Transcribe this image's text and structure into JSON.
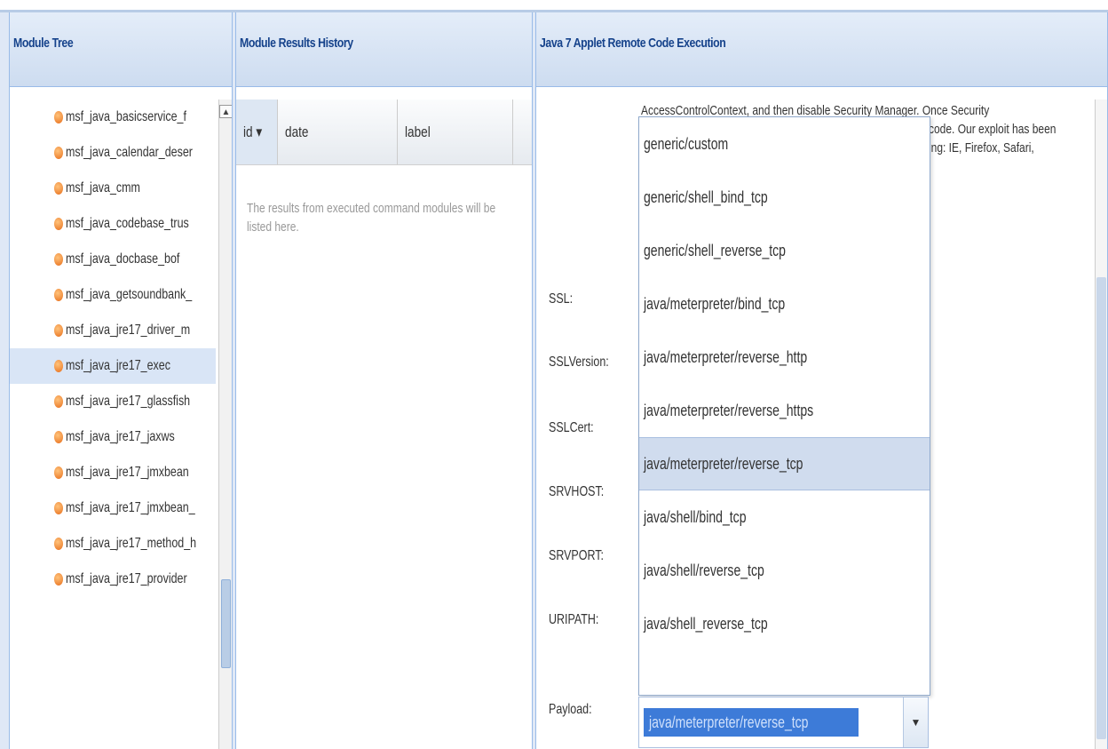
{
  "tree": {
    "title": "Module Tree",
    "items": [
      {
        "label": "msf_java_basicservice_f"
      },
      {
        "label": "msf_java_calendar_deser"
      },
      {
        "label": "msf_java_cmm"
      },
      {
        "label": "msf_java_codebase_trus"
      },
      {
        "label": "msf_java_docbase_bof"
      },
      {
        "label": "msf_java_getsoundbank_"
      },
      {
        "label": "msf_java_jre17_driver_m"
      },
      {
        "label": "msf_java_jre17_exec",
        "selected": true
      },
      {
        "label": "msf_java_jre17_glassfish"
      },
      {
        "label": "msf_java_jre17_jaxws"
      },
      {
        "label": "msf_java_jre17_jmxbean"
      },
      {
        "label": "msf_java_jre17_jmxbean_"
      },
      {
        "label": "msf_java_jre17_method_h"
      },
      {
        "label": "msf_java_jre17_provider"
      }
    ]
  },
  "history": {
    "title": "Module Results History",
    "columns": {
      "id": "id ▾",
      "date": "date",
      "label": "label"
    },
    "empty_text": "The results from executed command modules will be listed here."
  },
  "detail": {
    "title": "Java 7 Applet Remote Code Execution",
    "description": {
      "line1": "AccessControlContext, and then disable Security Manager. Once Security",
      "line2": "code. Our exploit has been",
      "line3": "ing: IE, Firefox, Safari,"
    },
    "fields": {
      "ssl": "SSL:",
      "ssl_version": "SSLVersion:",
      "ssl_cert": "SSLCert:",
      "srvhost": "SRVHOST:",
      "srvport": "SRVPORT:",
      "uripath": "URIPATH:",
      "payload": "Payload:"
    },
    "payload_options": [
      "generic/custom",
      "generic/shell_bind_tcp",
      "generic/shell_reverse_tcp",
      "java/meterpreter/bind_tcp",
      "java/meterpreter/reverse_http",
      "java/meterpreter/reverse_https",
      "java/meterpreter/reverse_tcp",
      "java/shell/bind_tcp",
      "java/shell/reverse_tcp",
      "java/shell_reverse_tcp"
    ],
    "payload_selected": "java/meterpreter/reverse_tcp"
  },
  "icons": {
    "scroll_up": "▲",
    "combo_arrow": "▼"
  },
  "colors": {
    "header": "#cddcf0",
    "title_text": "#15428b",
    "selection": "#d0dcee",
    "payload_highlight": "#3d7bd8",
    "bullet": "#e8701d"
  }
}
